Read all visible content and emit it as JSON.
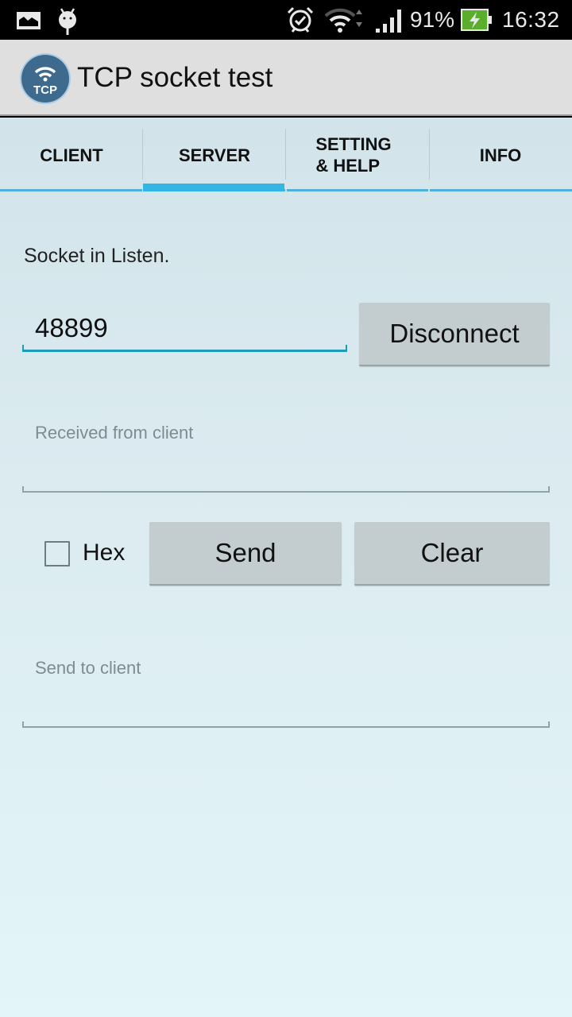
{
  "status_bar": {
    "left_icons": [
      "gallery-notification-icon",
      "android-debug-icon"
    ],
    "right_icons": [
      "alarm-icon",
      "wifi-icon",
      "signal-icon",
      "battery-charging-icon"
    ],
    "battery_percent": "91%",
    "time": "16:32"
  },
  "app": {
    "title": "TCP socket test",
    "logo_text": "TCP"
  },
  "tabs": [
    {
      "label": "CLIENT",
      "selected": false
    },
    {
      "label": "SERVER",
      "selected": true
    },
    {
      "label": "SETTING\n& HELP",
      "selected": false
    },
    {
      "label": "INFO",
      "selected": false
    }
  ],
  "server": {
    "status": "Socket in Listen.",
    "port_value": "48899",
    "disconnect_label": "Disconnect",
    "received": {
      "value": "",
      "placeholder": "Received from client"
    },
    "hex_label": "Hex",
    "hex_checked": false,
    "send_label": "Send",
    "clear_label": "Clear",
    "send_box": {
      "value": "",
      "placeholder": "Send to client"
    }
  },
  "colors": {
    "accent": "#33b5e5",
    "input_focus": "#1d9bb8",
    "action_bar": "#dfdfdf",
    "button": "#c3cdcf",
    "battery": "#5aae2c"
  }
}
